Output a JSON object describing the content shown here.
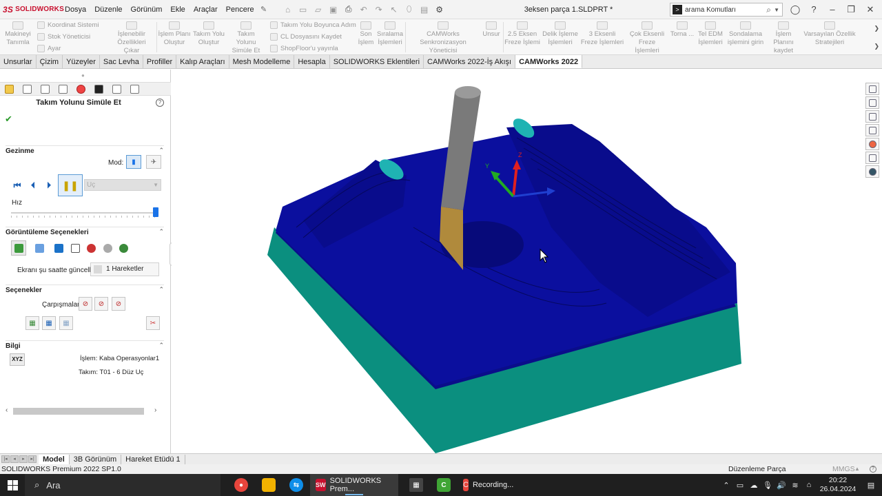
{
  "app": {
    "logo_text": "SOLIDWORKS",
    "document_title": "3eksen parça 1.SLDPRT *",
    "menu": [
      "Dosya",
      "Düzenle",
      "Görünüm",
      "Ekle",
      "Araçlar",
      "Pencere"
    ],
    "search_placeholder": "arama Komutları"
  },
  "command_manager": {
    "buttons": {
      "machine_def": "Makineyi Tanımla",
      "coord_system": "Koordinat Sistemi",
      "stock_manager": "Stok Yöneticisi",
      "settings": "Ayar",
      "extract_features": "İşlenebilir Özellikleri Çıkar",
      "gen_op_plan": "İşlem Planı Oluştur",
      "gen_toolpath": "Takım Yolu Oluştur",
      "simulate_toolpath": "Takım Yolunu Simüle Et",
      "step_through": "Takım Yolu Boyunca Adım",
      "cl_file": "CL Dosyasını Kaydet",
      "shopfloor": "ShopFloor'u yayınla",
      "post_process": "Son İşlem",
      "sort_ops": "Sıralama İşlemleri",
      "sync_manager": "CAMWorks Senkronizasyon Yöneticisi",
      "feature": "Unsur",
      "axis25_mill": "2.5 Eksen Freze İşlemi",
      "hole_ops": "Delik İşleme İşlemleri",
      "axis3_mill": "3 Eksenli Freze İşlemleri",
      "multi_axis": "Çok Eksenli Freze İşlemleri",
      "turn": "Torna ...",
      "wire_edm": "Tel EDM İşlemleri",
      "probing": "Sondalama işlemini girin",
      "save_plan": "İşlem Planını kaydet",
      "default_strategies": "Varsayılan Özellik Stratejileri"
    }
  },
  "tabs": [
    "Unsurlar",
    "Çizim",
    "Yüzeyler",
    "Sac Levha",
    "Profiller",
    "Kalıp Araçları",
    "Mesh Modelleme",
    "Hesapla",
    "SOLIDWORKS Eklentileri",
    "CAMWorks 2022-İş Akışı",
    "CAMWorks 2022"
  ],
  "active_tab": "CAMWorks 2022",
  "property_manager": {
    "title": "Takım Yolunu Simüle Et",
    "navigation": {
      "heading": "Gezinme",
      "mode_label": "Mod:",
      "step_select": "Uç",
      "speed_label": "Hız",
      "speed_fraction": 0.98
    },
    "display_options": {
      "heading": "Görüntüleme Seçenekleri",
      "update_label": "Ekranı şu saatte güncelle:",
      "update_value": "1 Hareketler"
    },
    "options": {
      "heading": "Seçenekler",
      "collisions_label": "Çarpışmalar:"
    },
    "info": {
      "heading": "Bilgi",
      "xyz": "XYZ",
      "operation": "İşlem: Kaba Operasyonlar1",
      "tool": "Takım: T01 - 6 Düz Uç"
    }
  },
  "viewport": {
    "triad": {
      "x": "",
      "y": "Y",
      "z": "Z"
    },
    "colors": {
      "part_top": "#0b0f9e",
      "part_side": "#0b8f7f",
      "tool_shank": "#7a7a7a",
      "tool_flute": "#b08a3c",
      "boss_cap": "#1fb3b3"
    }
  },
  "bottom_tabs": [
    "Model",
    "3B Görünüm",
    "Hareket Etüdü 1"
  ],
  "active_bottom_tab": "Model",
  "status": {
    "left": "SOLIDWORKS Premium 2022 SP1.0",
    "mode": "Düzenleme Parça",
    "units": "MMGS"
  },
  "taskbar": {
    "search_text": "Ara",
    "apps": [
      {
        "name": "chrome",
        "color": "#e8453c"
      },
      {
        "name": "file-explorer",
        "color": "#f2b200"
      },
      {
        "name": "teamviewer",
        "color": "#0e8ee9"
      }
    ],
    "solidworks_label": "SOLIDWORKS Prem...",
    "solidworks_badge": "SW",
    "recording_label": "Recording...",
    "time": "20:22",
    "date": "26.04.2024"
  }
}
